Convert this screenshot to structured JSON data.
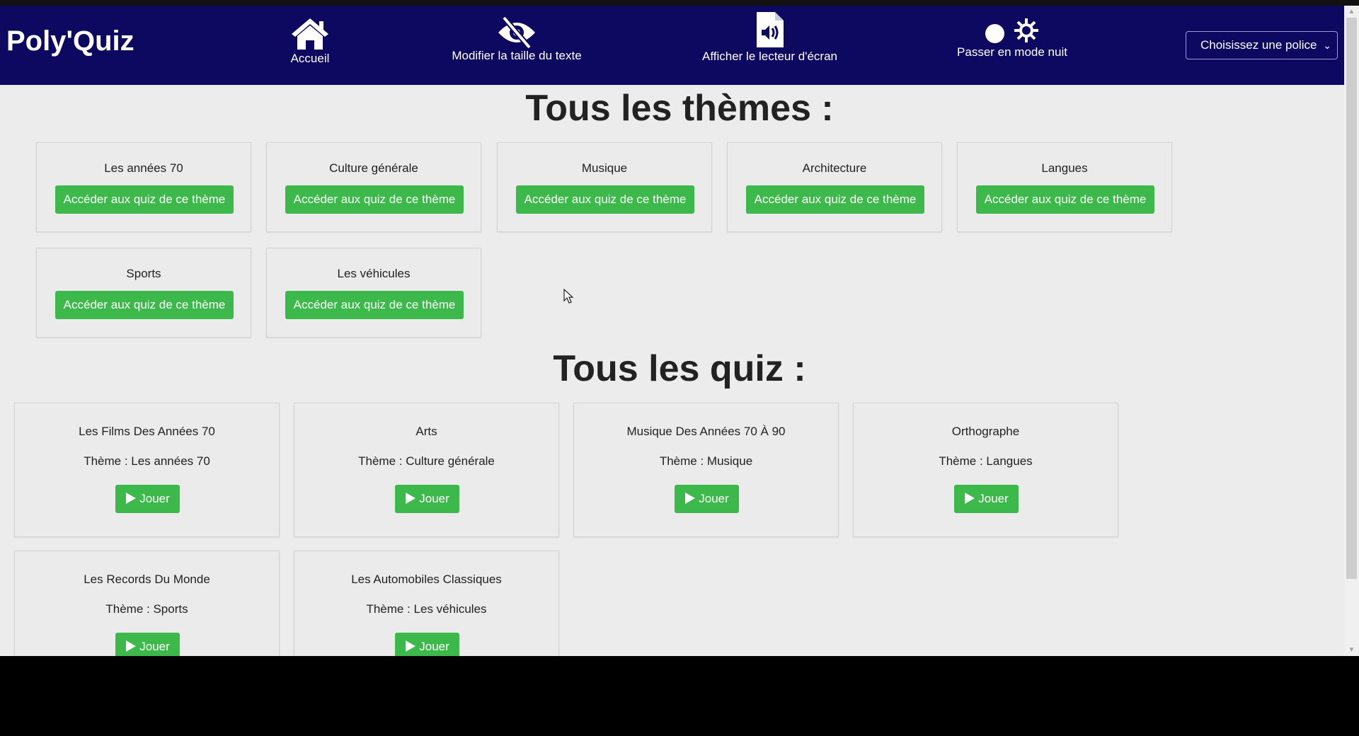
{
  "navbar": {
    "brand": "Poly'Quiz",
    "home_label": "Accueil",
    "text_size_label": "Modifier la taille du texte",
    "screen_reader_label": "Afficher le lecteur d'écran",
    "night_mode_label": "Passer en mode nuit",
    "font_select_value": "Choisissez une police"
  },
  "themes_section": {
    "title": "Tous les thèmes :",
    "button_label": "Accéder aux quiz de ce thème",
    "items": [
      {
        "name": "Les années 70"
      },
      {
        "name": "Culture générale"
      },
      {
        "name": "Musique"
      },
      {
        "name": "Architecture"
      },
      {
        "name": "Langues"
      },
      {
        "name": "Sports"
      },
      {
        "name": "Les véhicules"
      }
    ]
  },
  "quiz_section": {
    "title": "Tous les quiz :",
    "play_label": "Jouer",
    "items": [
      {
        "name": "Les Films Des Années 70",
        "theme": "Thème : Les années 70"
      },
      {
        "name": "Arts",
        "theme": "Thème : Culture générale"
      },
      {
        "name": "Musique Des Années 70 À 90",
        "theme": "Thème : Musique"
      },
      {
        "name": "Orthographe",
        "theme": "Thème : Langues"
      },
      {
        "name": "Les Records Du Monde",
        "theme": "Thème : Sports"
      },
      {
        "name": "Les Automobiles Classiques",
        "theme": "Thème : Les véhicules"
      }
    ]
  },
  "colors": {
    "navbar_bg": "#0d0860",
    "page_bg": "#ececec",
    "accent_green": "#3cb94a"
  }
}
